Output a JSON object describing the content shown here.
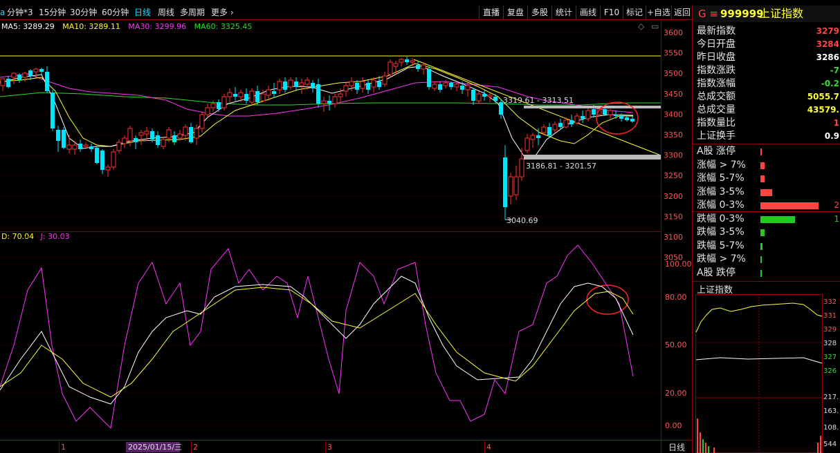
{
  "toolbar": {
    "left_items": [
      "分钟*3",
      "15分钟",
      "30分钟",
      "60分钟",
      "日线",
      "周线",
      "多周期",
      "更多"
    ],
    "active_item": "日线",
    "right_buttons": [
      "直播",
      "复盘",
      "多股",
      "统计",
      "画线",
      "F10",
      "标记",
      "+自选",
      "返回"
    ]
  },
  "ma_legend": {
    "ma5": "MA5: 3289.29",
    "ma10": "MA10: 3289.11",
    "ma30": "MA30: 3299.96",
    "ma60": "MA60: 3325.45"
  },
  "kdj_legend": {
    "d": "D: 70.04",
    "j": "J: 30.03"
  },
  "price_axis": [
    "3600",
    "3550",
    "3500",
    "3450",
    "3400",
    "3350",
    "3300",
    "3250",
    "3200",
    "3150",
    "3100",
    "3050"
  ],
  "kdj_axis": [
    "100.00",
    "80.00",
    "50.00",
    "20.00",
    "0.00"
  ],
  "annotations": {
    "upper_zone": "3319.61 - 3313.51",
    "lower_zone": "3186.81 - 3201.57",
    "low_point": "3040.69"
  },
  "time_axis": {
    "m1": "1",
    "date_box": "2025/01/15/三",
    "m2": "2",
    "m3": "3",
    "m4": "4",
    "period_tab": "日线"
  },
  "quote": {
    "code": "999999",
    "name": "上证指数",
    "prefix": "G ≡",
    "rows": [
      {
        "label": "最新指数",
        "value": "3279",
        "color": "#ff4444"
      },
      {
        "label": "今日开盘",
        "value": "3284",
        "color": "#ff4444"
      },
      {
        "label": "昨日收盘",
        "value": "3286",
        "color": "#ffffff"
      },
      {
        "label": "指数涨跌",
        "value": "-7",
        "color": "#33dd33"
      },
      {
        "label": "指数涨幅",
        "value": "-0.2",
        "color": "#33dd33"
      },
      {
        "label": "总成交额",
        "value": "5055.7",
        "color": "#ffff33"
      },
      {
        "label": "总成交量",
        "value": "43579.",
        "color": "#ffff33"
      },
      {
        "label": "指数量比",
        "value": "1",
        "color": "#ff4444"
      },
      {
        "label": "上证换手",
        "value": "0.9",
        "color": "#ffffff"
      }
    ]
  },
  "distribution": [
    {
      "label": "A股 涨停",
      "count": "",
      "color": "#ff4444",
      "width": 0.02
    },
    {
      "label": "涨幅 > 7%",
      "count": "",
      "color": "#ff4444",
      "width": 0.05
    },
    {
      "label": "涨幅 5-7%",
      "count": "",
      "color": "#ff4444",
      "width": 0.05
    },
    {
      "label": "涨幅 3-5%",
      "count": "",
      "color": "#ff4444",
      "width": 0.15
    },
    {
      "label": "涨幅 0-3%",
      "count": "2",
      "color": "#ff4444",
      "width": 0.75
    },
    {
      "label": "跌幅 0-3%",
      "count": "1",
      "color": "#22cc22",
      "width": 0.45
    },
    {
      "label": "跌幅 3-5%",
      "count": "",
      "color": "#22cc22",
      "width": 0.05
    },
    {
      "label": "跌幅 5-7%",
      "count": "",
      "color": "#22cc22",
      "width": 0.03
    },
    {
      "label": "跌幅 > 7%",
      "count": "",
      "color": "#22cc22",
      "width": 0.01
    },
    {
      "label": "A股 跌停",
      "count": "",
      "color": "#22cc22",
      "width": 0.01
    }
  ],
  "mini_chart": {
    "title": "上证指数",
    "axis": [
      "332",
      "331",
      "329",
      "328",
      "327",
      "326",
      "217.",
      "163.",
      "108.",
      "544"
    ]
  },
  "colors": {
    "up": "#ff3333",
    "down": "#00e5ff",
    "ma5": "#ffffff",
    "ma10": "#ffff33",
    "ma30": "#ff33ff",
    "ma60": "#22dd22",
    "grid": "#8b0000"
  }
}
